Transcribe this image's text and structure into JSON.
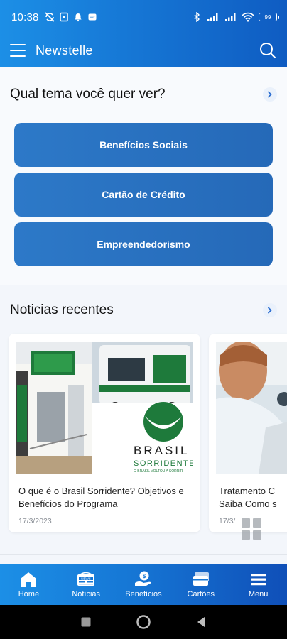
{
  "status_bar": {
    "time": "10:38",
    "battery": "99"
  },
  "app_bar": {
    "title": "Newstelle"
  },
  "topics_section": {
    "title": "Qual tema você quer ver?",
    "topics": [
      {
        "label": "Benefícios Sociais"
      },
      {
        "label": "Cartão de Crédito"
      },
      {
        "label": "Empreendedorismo"
      }
    ]
  },
  "news_section": {
    "title": "Noticias recentes",
    "articles": [
      {
        "title": "O que é o Brasil Sorridente? Objetivos e Benefícios do Programa",
        "date": "17/3/2023",
        "thumb_text_main": "BRASIL",
        "thumb_text_sub": "SORRIDENTE",
        "thumb_text_tagline": "O BRASIL VOLTOU A SORRIR"
      },
      {
        "title": "Tratamento C... Saiba Como s...",
        "date": "17/3/",
        "title_line1": "Tratamento C",
        "title_line2": "Saiba Como s"
      }
    ]
  },
  "bottom_nav": {
    "items": [
      {
        "label": "Home",
        "icon": "home-icon"
      },
      {
        "label": "Notícias",
        "icon": "news-icon"
      },
      {
        "label": "Benefícios",
        "icon": "benefits-icon"
      },
      {
        "label": "Cartões",
        "icon": "cards-icon"
      },
      {
        "label": "Menu",
        "icon": "menu-icon"
      }
    ]
  },
  "colors": {
    "brand_blue": "#1677d5",
    "topic_button": "#2a70bf"
  }
}
